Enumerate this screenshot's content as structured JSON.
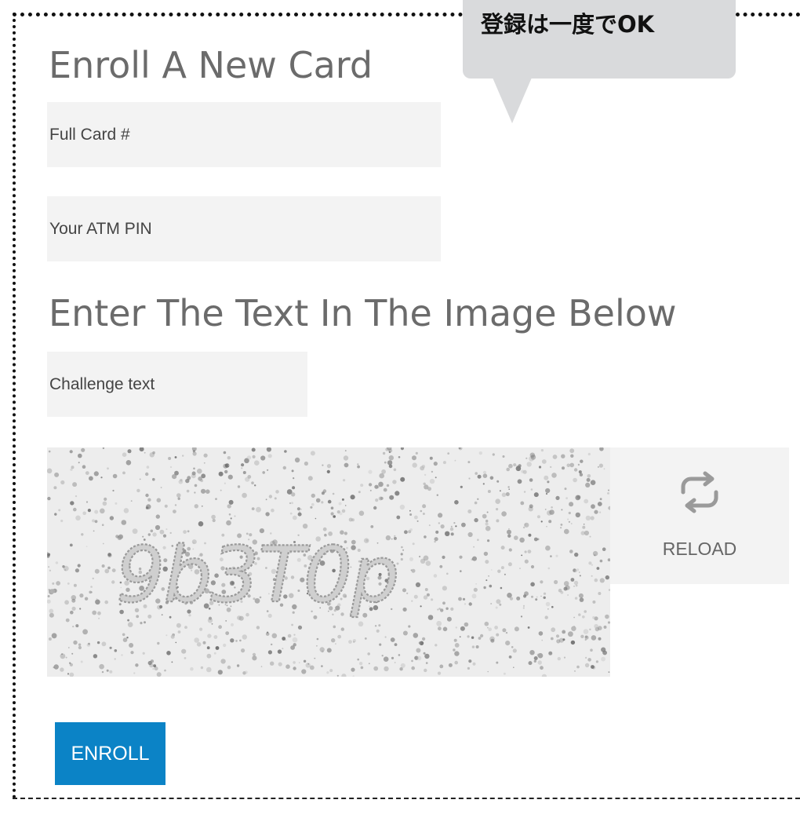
{
  "enroll_heading": "Enroll A New Card",
  "card_field": {
    "placeholder": "Full Card #"
  },
  "pin_field": {
    "placeholder": "Your ATM PIN"
  },
  "captcha_heading": "Enter The Text In The Image Below",
  "challenge_field": {
    "placeholder": "Challenge text"
  },
  "captcha": {
    "text": "9b3T0p"
  },
  "reload": {
    "label": "RELOAD",
    "icon": "repeat-icon"
  },
  "enroll_button": {
    "label": "ENROLL",
    "color": "#0b83c6"
  },
  "callout": {
    "text": "登録は一度でOK",
    "color": "#d9dadc"
  }
}
